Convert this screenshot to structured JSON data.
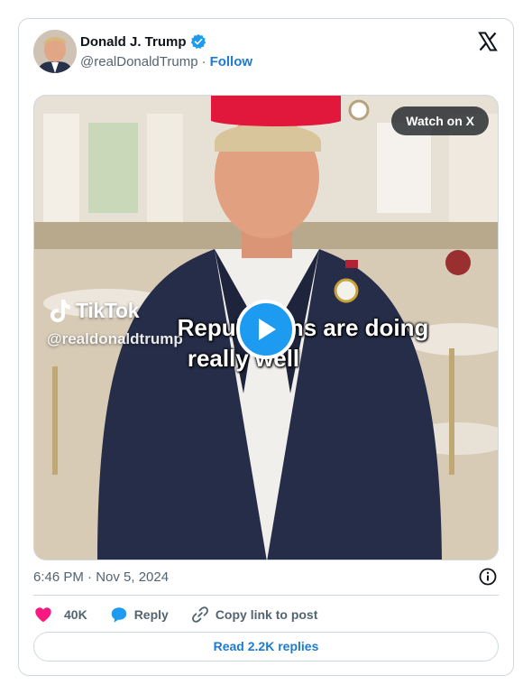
{
  "author": {
    "name": "Donald J. Trump",
    "handle": "@realDonaldTrump",
    "separator": "·",
    "follow_label": "Follow",
    "verified_color": "#1d9bf0"
  },
  "media": {
    "watch_label": "Watch on X",
    "tiktok_brand": "TikTok",
    "tiktok_handle": "@realdonaldtrump",
    "caption_line1": "Republicans are doing",
    "caption_line2": "really well"
  },
  "meta": {
    "timestamp": "6:46 PM · Nov 5, 2024"
  },
  "actions": {
    "likes_count": "40K",
    "reply_label": "Reply",
    "copy_link_label": "Copy link to post",
    "like_color": "#f91880",
    "reply_color": "#1d9bf0"
  },
  "footer": {
    "read_replies_label": "Read 2.2K replies"
  },
  "icons": [
    "verified-badge-icon",
    "x-logo-icon",
    "tiktok-logo-icon",
    "play-icon",
    "info-icon",
    "heart-icon",
    "speech-bubble-icon",
    "link-icon"
  ]
}
